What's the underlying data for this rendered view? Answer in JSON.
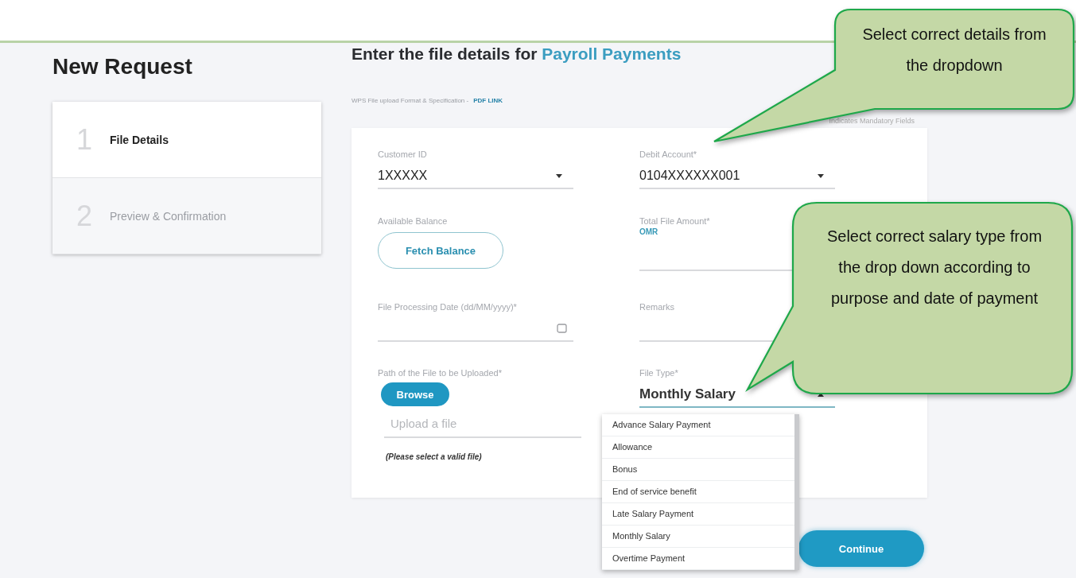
{
  "page": {
    "title": "New Request"
  },
  "steps": [
    {
      "number": "1",
      "label": "File Details",
      "selected": true
    },
    {
      "number": "2",
      "label": "Preview & Confirmation",
      "selected": false
    }
  ],
  "form": {
    "heading": "Enter the file details for",
    "heading_highlight": "Payroll Payments",
    "spec_text": "WPS File upload Format & Specification -",
    "spec_link": "PDF LINK",
    "mandatory_note": "Indicates Mandatory Fields",
    "fields": [
      {
        "kind": "select",
        "label": "Customer ID",
        "value": "1XXXXX",
        "expanded": false
      },
      {
        "kind": "select",
        "label": "Debit Account*",
        "value": "0104XXXXXX001",
        "expanded": false
      },
      {
        "kind": "button",
        "label": "Available Balance",
        "button": "Fetch Balance"
      },
      {
        "kind": "amount",
        "label": "Total File Amount*",
        "currency": "OMR"
      },
      {
        "kind": "date",
        "label": "File Processing Date (dd/MM/yyyy)*"
      },
      {
        "kind": "text",
        "label": "Remarks"
      },
      {
        "kind": "upload",
        "label": "Path of the File to be Uploaded*",
        "button": "Browse",
        "placeholder": "Upload a file",
        "hint": "(Please select a valid file)"
      },
      {
        "kind": "select",
        "label": "File Type*",
        "value": "Monthly Salary",
        "expanded": true,
        "options": [
          "Advance Salary Payment",
          "Allowance",
          "Bonus",
          "End of service benefit",
          "Late Salary Payment",
          "Monthly Salary",
          "Overtime Payment"
        ]
      }
    ]
  },
  "continue_button": "Continue",
  "callouts": [
    {
      "text": "Select correct details from the dropdown"
    },
    {
      "text": "Select correct salary type from the drop down according to purpose and date of payment"
    }
  ]
}
